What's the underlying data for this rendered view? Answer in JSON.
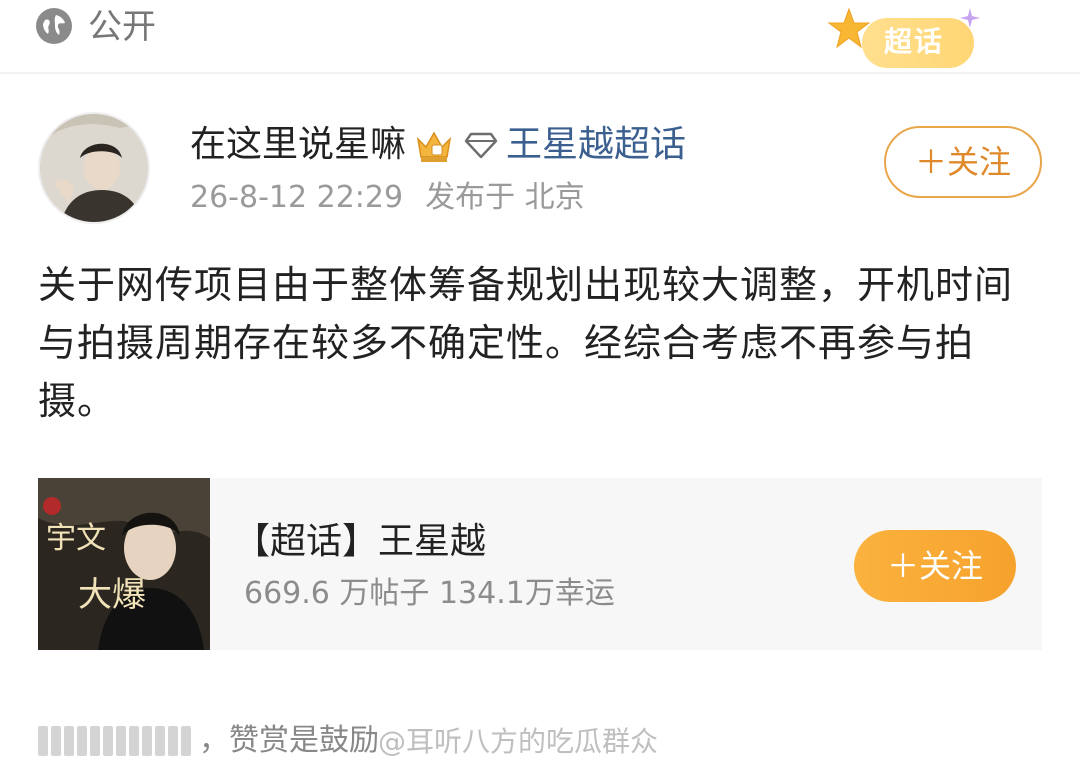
{
  "visibility": {
    "label": "公开",
    "icon": "globe-icon"
  },
  "chaohua_badge": {
    "label": "超话",
    "icons": [
      "star-icon",
      "sparkle-icon"
    ]
  },
  "post": {
    "author": "在这里说星嘛",
    "author_badge_icon": "crown-icon",
    "topic_icon": "diamond-icon",
    "topic_link": "王星越超话",
    "time": "26-8-12 22:29",
    "location": "发布于 北京",
    "follow_label": "＋关注",
    "body": "关于网传项目由于整体筹备规划出现较大调整，开机时间与拍摄周期存在较多不确定性。经综合考虑不再参与拍摄。"
  },
  "topic_card": {
    "title": "【超话】王星越",
    "stats": "669.6 万帖子  134.1万幸运",
    "follow_label": "＋关注"
  },
  "reward": {
    "text": "，赞赏是鼓励"
  },
  "watermark": {
    "text": "@耳听八方的吃瓜群众"
  },
  "colors": {
    "accent_orange": "#f6a22d",
    "link_blue": "#3b5f8f",
    "meta_gray": "#9a9a9a"
  }
}
